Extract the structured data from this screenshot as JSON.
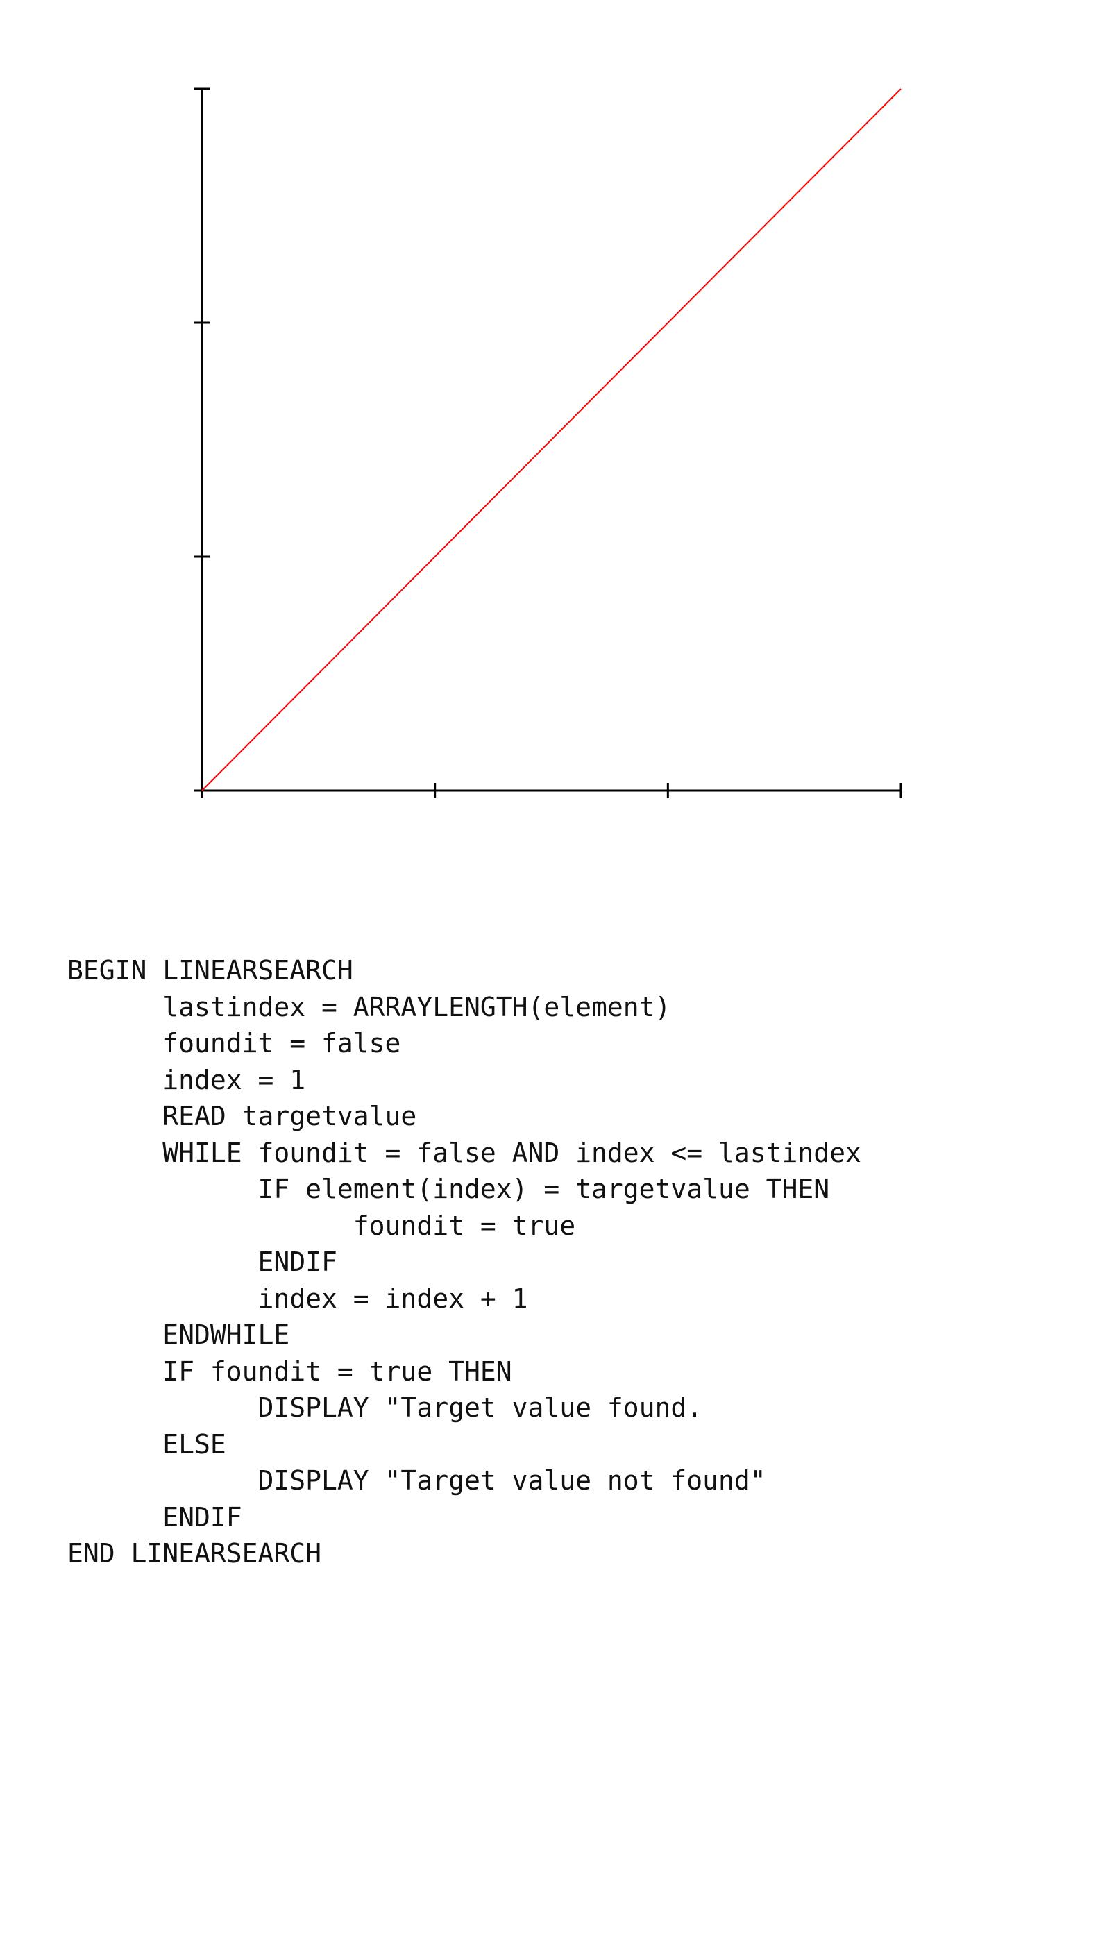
{
  "chart_data": {
    "type": "line",
    "title": "",
    "xlabel": "",
    "ylabel": "",
    "xlim": [
      0,
      3
    ],
    "ylim": [
      0,
      3
    ],
    "x_ticks": [
      0,
      1,
      2,
      3
    ],
    "y_ticks": [
      0,
      1,
      2,
      3
    ],
    "tick_labels_shown": false,
    "grid": false,
    "legend": "none",
    "series": [
      {
        "x": [
          0,
          3
        ],
        "y": [
          0,
          3
        ],
        "color": "#ff0000"
      }
    ],
    "axis_color": "#000000"
  },
  "code": {
    "lines": [
      "BEGIN LINEARSEARCH",
      "      lastindex = ARRAYLENGTH(element)",
      "      foundit = false",
      "      index = 1",
      "      READ targetvalue",
      "      WHILE foundit = false AND index <= lastindex",
      "            IF element(index) = targetvalue THEN",
      "                  foundit = true",
      "            ENDIF",
      "            index = index + 1",
      "      ENDWHILE",
      "      IF foundit = true THEN",
      "            DISPLAY \"Target value found.",
      "      ELSE",
      "            DISPLAY \"Target value not found\"",
      "      ENDIF",
      "END LINEARSEARCH"
    ]
  }
}
